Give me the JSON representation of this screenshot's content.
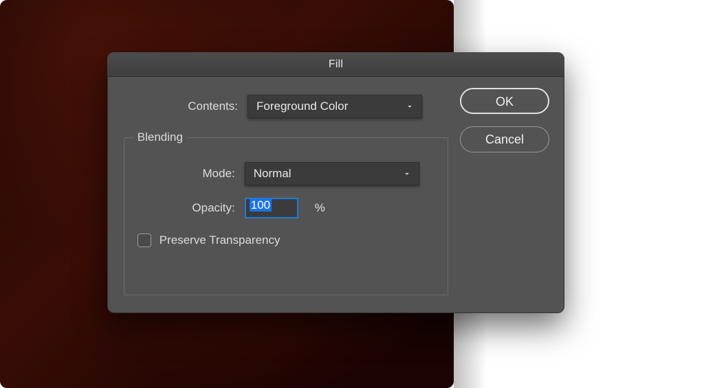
{
  "dialog": {
    "title": "Fill",
    "buttons": {
      "ok": "OK",
      "cancel": "Cancel"
    },
    "contents": {
      "label": "Contents:",
      "value": "Foreground Color"
    },
    "blending": {
      "legend": "Blending",
      "mode": {
        "label": "Mode:",
        "value": "Normal"
      },
      "opacity": {
        "label": "Opacity:",
        "value": "100",
        "unit": "%"
      },
      "preserve": {
        "label": "Preserve Transparency",
        "checked": false
      }
    }
  }
}
